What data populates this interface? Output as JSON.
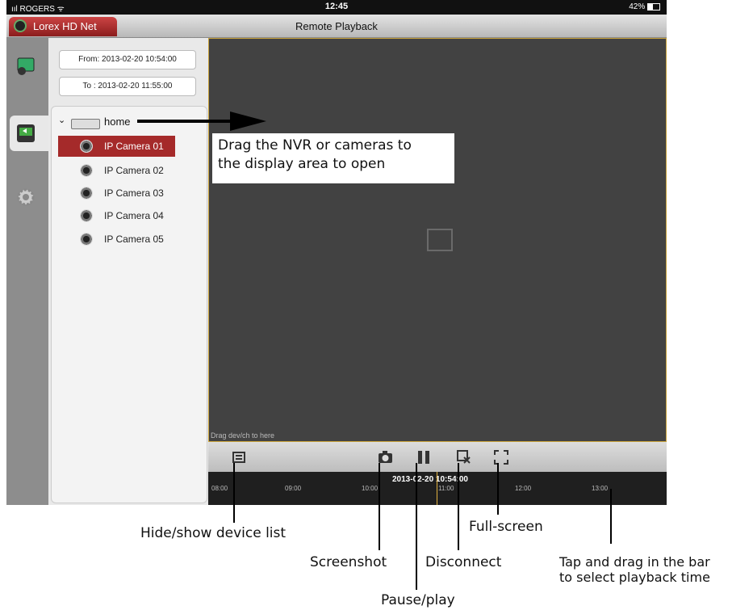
{
  "status_bar": {
    "carrier": "ııl ROGERS ᯤ",
    "time": "12:45",
    "battery": "42%"
  },
  "app": {
    "tab_name": "Lorex HD Net",
    "screen_title": "Remote Playback"
  },
  "time_range": {
    "from": "From: 2013-02-20 10:54:00",
    "to": "To  : 2013-02-20 11:55:00"
  },
  "device_tree": {
    "root": "home",
    "cameras": [
      "IP Camera 01",
      "IP Camera 02",
      "IP Camera 03",
      "IP Camera 04",
      "IP Camera 05"
    ],
    "selected_index": 0
  },
  "video_area": {
    "hint": "Drag dev/ch to here"
  },
  "timeline": {
    "current": "2013-02-20 10:54:00",
    "ticks": [
      "08:00",
      "09:00",
      "10:00",
      "11:00",
      "12:00",
      "13:00"
    ]
  },
  "annotations": {
    "drag_note_line1": "Drag the NVR or cameras to",
    "drag_note_line2": "the display area to open",
    "hide_show": "Hide/show device list",
    "screenshot": "Screenshot",
    "pause_play": "Pause/play",
    "disconnect": "Disconnect",
    "full_screen": "Full-screen",
    "tap_drag_line1": "Tap and drag in the bar",
    "tap_drag_line2": "to select playback time"
  },
  "icons": [
    "monitor-icon",
    "playback-icon",
    "settings-icon",
    "device-list-icon",
    "camera-icon",
    "pause-icon",
    "disconnect-icon",
    "fullscreen-icon"
  ],
  "colors": {
    "accent": "#a52a2a",
    "video_bg": "#424242",
    "timeline_bg": "#1f1f1f",
    "cursor": "#e0b040"
  }
}
